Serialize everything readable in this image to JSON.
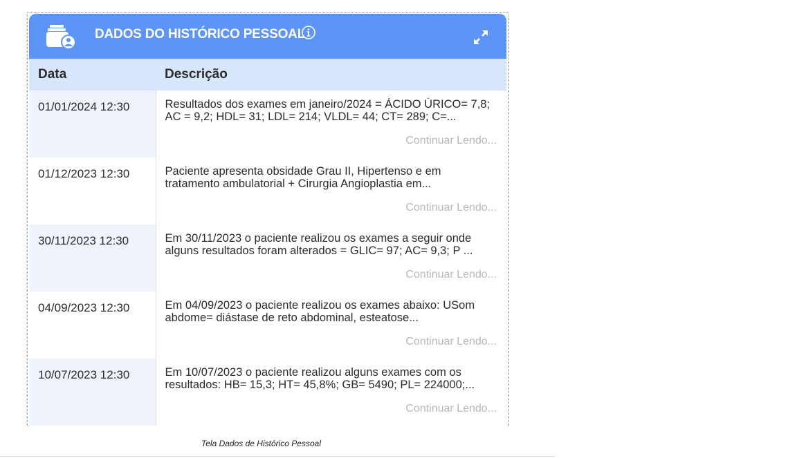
{
  "widget": {
    "title": "DADOS DO HISTÓRICO PESSOAL",
    "header_color": "#5c94f7",
    "icons": {
      "header": "folder-user-icon",
      "info": "info-icon",
      "expand": "expand-icon"
    }
  },
  "table": {
    "columns": [
      "Data",
      "Descrição"
    ],
    "rows": [
      {
        "date": "01/01/2024 12:30",
        "description": "Resultados dos exames em janeiro/2024 = ÁCIDO ÚRICO= 7,8; AC = 9,2; HDL= 31; LDL= 214; VLDL= 44; CT= 289; C=...",
        "read_more": "Continuar Lendo..."
      },
      {
        "date": "01/12/2023 12:30",
        "description": "Paciente apresenta obsidade Grau II, Hipertenso e em tratamento ambulatorial + Cirurgia Angioplastia em...",
        "read_more": "Continuar Lendo..."
      },
      {
        "date": "30/11/2023 12:30",
        "description": "Em 30/11/2023 o paciente realizou os exames a seguir onde alguns resultados foram alterados = GLIC= 97; AC= 9,3; P ...",
        "read_more": "Continuar Lendo..."
      },
      {
        "date": "04/09/2023 12:30",
        "description": "Em 04/09/2023 o paciente realizou os exames abaixo: USom abdome= diástase de reto abdominal, esteatose...",
        "read_more": "Continuar Lendo..."
      },
      {
        "date": "10/07/2023 12:30",
        "description": "Em 10/07/2023 o paciente realizou alguns exames com os resultados: HB= 15,3; HT= 45,8%; GB= 5490; PL= 224000;...",
        "read_more": "Continuar Lendo..."
      }
    ]
  },
  "caption": "Tela Dados de Histórico Pessoal"
}
